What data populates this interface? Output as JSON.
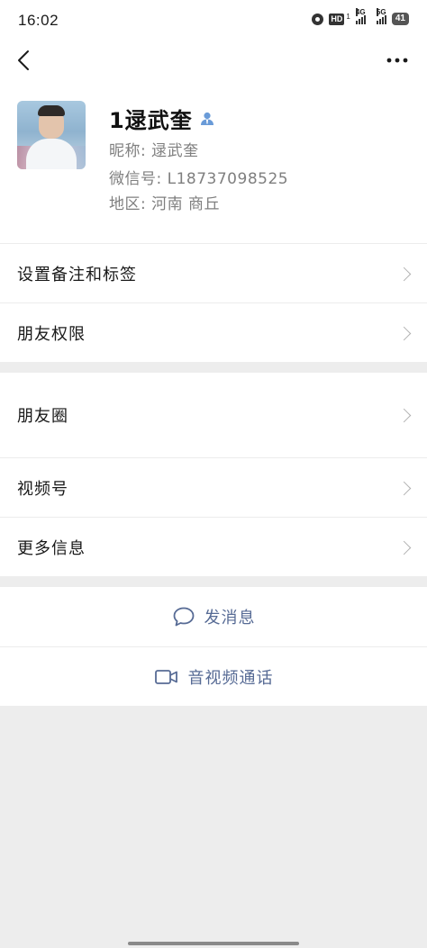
{
  "status_bar": {
    "time": "16:02",
    "hd": "HD",
    "hd_sub": "1",
    "net_4g": "4G",
    "net_5g": "5G",
    "battery": "41"
  },
  "nav": {
    "back_icon": "chevron-left-icon",
    "more_icon": "more-dots-icon"
  },
  "profile": {
    "name": "1逯武奎",
    "name_badge_icon": "contact-person-icon",
    "nickname": "昵称: 逯武奎",
    "wechat_id": "微信号: L18737098525",
    "region": "地区: 河南  商丘"
  },
  "group1": {
    "items": [
      {
        "label": "设置备注和标签"
      },
      {
        "label": "朋友权限"
      }
    ]
  },
  "group2": {
    "items": [
      {
        "label": "朋友圈"
      },
      {
        "label": "视频号"
      },
      {
        "label": "更多信息"
      }
    ]
  },
  "actions": {
    "message_label": "发消息",
    "call_label": "音视频通话",
    "accent_color": "#576b95"
  }
}
